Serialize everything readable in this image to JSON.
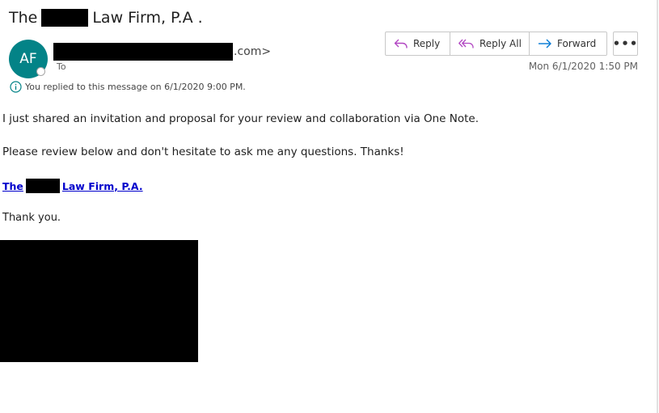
{
  "email": {
    "subject_prefix": "The",
    "subject_suffix": "Law Firm, P.A .",
    "sender_initials": "AF",
    "sender_domain_suffix": ".com>",
    "to_label": "To",
    "timestamp": "Mon 6/1/2020 1:50 PM",
    "reply_notice": "You replied to this message on 6/1/2020 9:00 PM."
  },
  "actions": {
    "reply_label": "Reply",
    "reply_all_label": "Reply All",
    "forward_label": "Forward",
    "more_label": "•••"
  },
  "body": {
    "paragraph1": "I just shared an invitation and proposal for your review and collaboration via One Note.",
    "paragraph2": "Please review below and don't hesitate to ask me any questions. Thanks!",
    "link_prefix": "The",
    "link_suffix": "Law Firm, P.A.",
    "closing": "Thank you."
  },
  "colors": {
    "avatar": "#038387",
    "reply_icon": "#b146c2",
    "forward_icon": "#0078d4",
    "link": "#0000cc",
    "info_icon": "#038387"
  },
  "icons": {
    "reply": "reply-arrow-icon",
    "reply_all": "reply-all-arrow-icon",
    "forward": "forward-arrow-icon",
    "info": "info-circle-icon"
  }
}
